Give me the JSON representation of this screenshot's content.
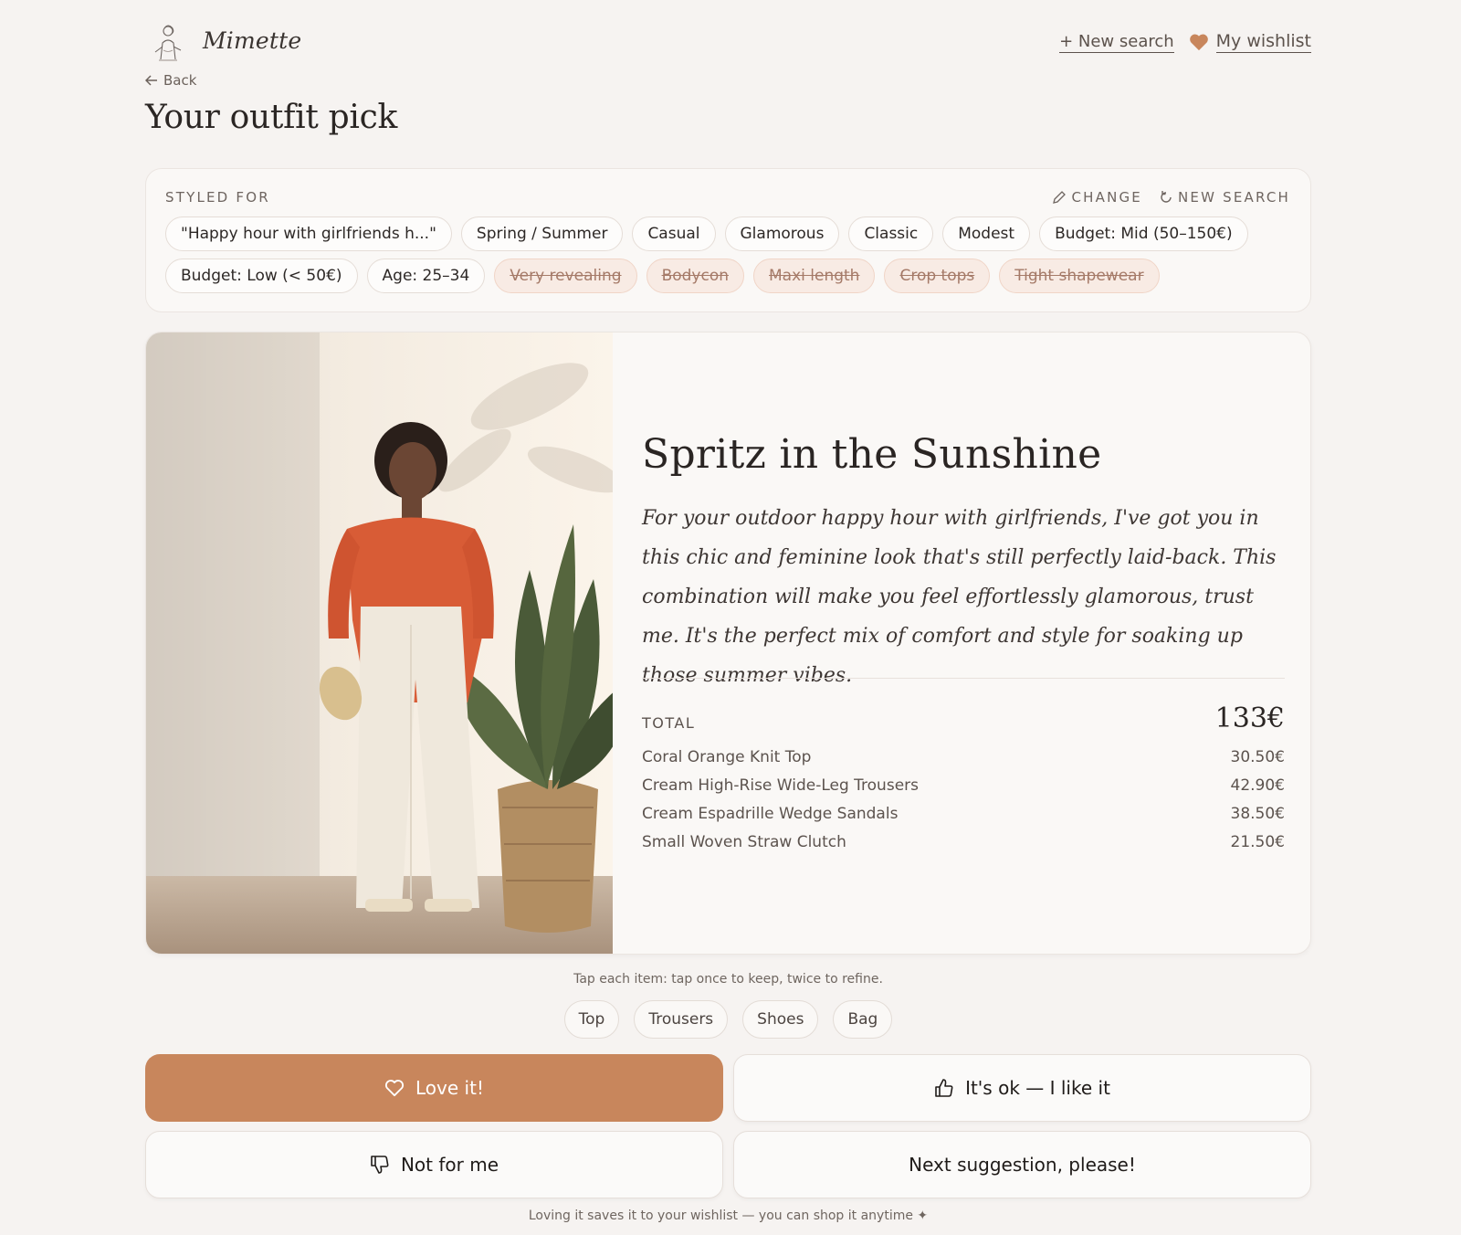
{
  "header": {
    "brand": "Mimette",
    "new_search": "+ New search",
    "wishlist": "My wishlist"
  },
  "nav": {
    "back": "Back"
  },
  "page_title": "Your outfit pick",
  "styled_for": {
    "label": "STYLED FOR",
    "change": "CHANGE",
    "new_search": "NEW SEARCH",
    "chips": [
      "\"Happy hour with girlfriends h...\"",
      "Spring / Summer",
      "Casual",
      "Glamorous",
      "Classic",
      "Modest",
      "Budget: Mid (50–150€)",
      "Budget: Low (< 50€)",
      "Age: 25–34"
    ],
    "excluded": [
      "Very revealing",
      "Bodycon",
      "Maxi length",
      "Crop tops",
      "Tight shapewear"
    ]
  },
  "outfit": {
    "title": "Spritz in the Sunshine",
    "description": "For your outdoor happy hour with girlfriends, I've got you in this chic and feminine look that's still perfectly laid-back. This combination will make you feel effortlessly glamorous, trust me. It's the perfect mix of comfort and style for soaking up those summer vibes.",
    "total_label": "TOTAL",
    "total_value": "133€",
    "items": [
      {
        "name": "Coral Orange Knit Top",
        "price": "30.50€"
      },
      {
        "name": "Cream High-Rise Wide-Leg Trousers",
        "price": "42.90€"
      },
      {
        "name": "Cream Espadrille Wedge Sandals",
        "price": "38.50€"
      },
      {
        "name": "Small Woven Straw Clutch",
        "price": "21.50€"
      }
    ]
  },
  "hint": "Tap each item: tap once to keep, twice to refine.",
  "pieces": [
    "Top",
    "Trousers",
    "Shoes",
    "Bag"
  ],
  "actions": {
    "love": "Love it!",
    "ok": "It's ok — I like it",
    "not_for_me": "Not for me",
    "next": "Next suggestion, please!"
  },
  "footer_note": "Loving it saves it to your wishlist — you can shop it anytime ✦",
  "colors": {
    "accent": "#c8865c",
    "background": "#f6f3f1",
    "excluded_chip_bg": "#f8ebe4"
  }
}
